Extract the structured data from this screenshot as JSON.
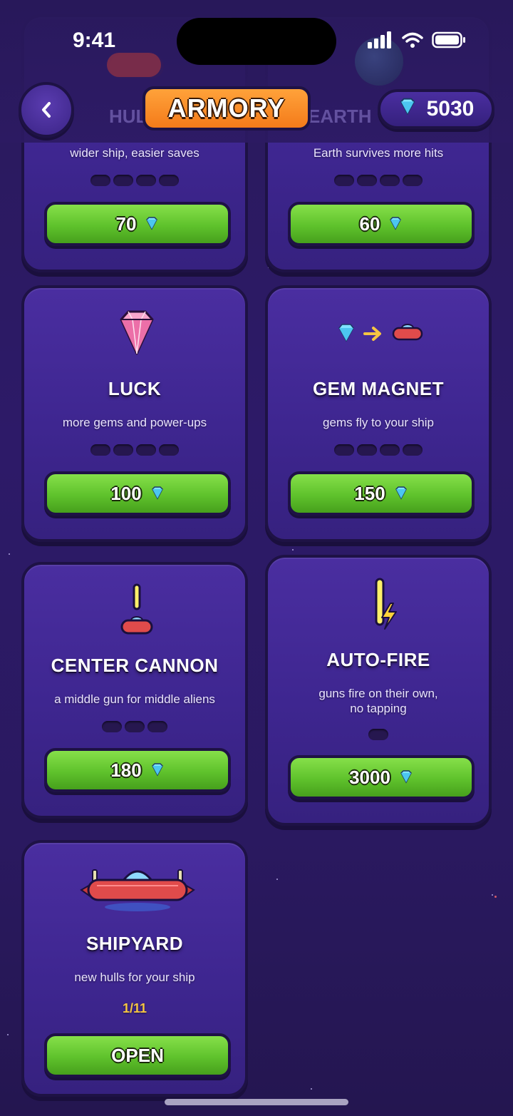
{
  "status_bar": {
    "time": "9:41"
  },
  "header": {
    "title": "ARMORY",
    "gem_count": "5030",
    "faded_left": "HUL",
    "faded_right": "EARTH"
  },
  "cards": {
    "hull": {
      "desc": "wider ship, easier saves",
      "price": "70",
      "pips": 4
    },
    "earth": {
      "desc": "Earth survives more hits",
      "price": "60",
      "pips": 4
    },
    "luck": {
      "title": "LUCK",
      "desc": "more gems and power-ups",
      "price": "100",
      "pips": 4
    },
    "gem_magnet": {
      "title": "GEM MAGNET",
      "desc": "gems fly to your ship",
      "price": "150",
      "pips": 4
    },
    "center_cannon": {
      "title": "CENTER CANNON",
      "desc": "a middle gun for middle aliens",
      "price": "180",
      "pips": 3
    },
    "auto_fire": {
      "title": "AUTO-FIRE",
      "desc_line1": "guns fire on their own,",
      "desc_line2": "no tapping",
      "price": "3000",
      "pips": 1
    },
    "shipyard": {
      "title": "SHIPYARD",
      "desc": "new hulls for your ship",
      "level": "1/11",
      "button": "OPEN"
    }
  },
  "icons": {
    "back": "chevron-left-icon",
    "currency": "diamond-gem-icon",
    "luck": "pink-gem-icon",
    "gem_magnet": "gem-arrow-ship-icon",
    "center_cannon": "cannon-ship-icon",
    "auto_fire": "lightning-cannon-icon",
    "shipyard": "ufo-ship-icon"
  },
  "colors": {
    "button_green": "#5fc22c",
    "title_orange": "#f47b1a",
    "card_purple": "#3e2690",
    "level_gold": "#f5c542"
  }
}
